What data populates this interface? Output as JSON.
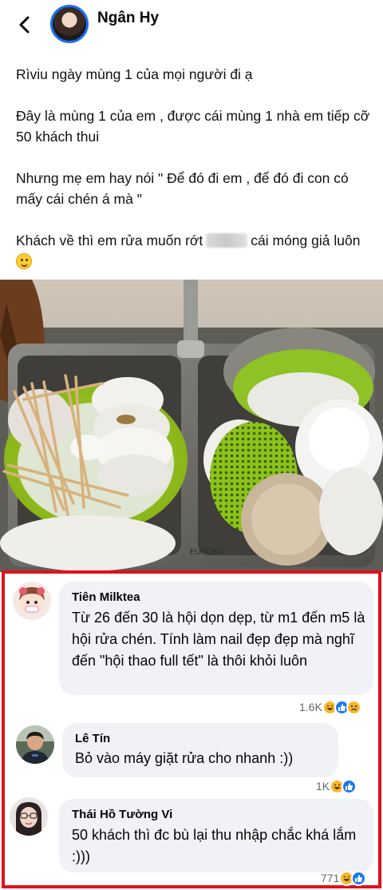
{
  "header": {
    "name": "Ngân Hy"
  },
  "post": {
    "lines": [
      "Rìviu ngày mùng 1 của mọi người đi ạ",
      "Đây là mùng 1 của em , được cái mùng 1 nhà em tiếp cỡ 50 khách thui",
      "Nhưng mẹ em hay nói \" Để đó đi em , để đó đi con có mấy cái chén á mà \"",
      "Khách về thì em rửa muốn rớt",
      "cái móng giả luôn"
    ]
  },
  "photo": {
    "brand": "EUROKA"
  },
  "comments": [
    {
      "name": "Tiên Milktea",
      "text": "Từ 26 đến 30 là hội dọn dẹp, từ m1 đến m5 là hội rửa chén. Tính làm nail đẹp đẹp mà nghĩ đến \"hội thao full tết\" là thôi khỏi luôn",
      "reaction_count": "1.6K"
    },
    {
      "name": "Lê Tín",
      "text": "Bỏ vào máy giặt rửa cho nhanh :))",
      "reaction_count": "1K"
    },
    {
      "name": "Thái Hồ Tường Vi",
      "text": "50 khách thì đc bù lại thu nhập chắc khá lắm :)))",
      "reaction_count": "771"
    }
  ],
  "colors": {
    "highlight_border": "#e0111a",
    "bubble": "#f0f2f5",
    "like_blue": "#1877f2",
    "haha_yellow": "#f7b928"
  },
  "icons": [
    "back-arrow-icon",
    "haha-reaction-icon",
    "like-reaction-icon",
    "sad-reaction-icon",
    "smile-emoji-icon"
  ]
}
